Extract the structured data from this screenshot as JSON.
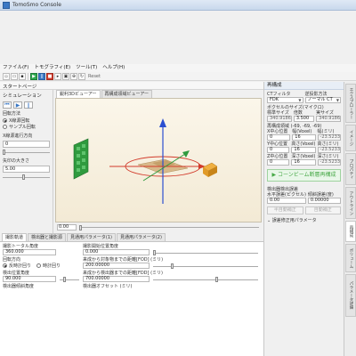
{
  "window": {
    "title": "TomoSmo Console"
  },
  "menu": [
    "ファイル(F)",
    "トモグラフィ(E)",
    "ツール(T)",
    "ヘルプ(H)"
  ],
  "toolbar": {
    "reset_label": "Reset"
  },
  "start_page": "スタートページ",
  "simulation": {
    "title": "シミュレーション",
    "rotation_method_label": "回転方法",
    "rotation_options": [
      "X線源回転",
      "サンプル回転"
    ],
    "xray_direction_label": "X線源進行方向",
    "xray_direction_value": "0",
    "arrow_size_label": "矢印の大きさ",
    "arrow_size_value": "5.00"
  },
  "viewer": {
    "tabs": [
      "鋭利3Dビューアー",
      "再構成領域ビューアー"
    ],
    "slider_value": "0.00"
  },
  "bottom": {
    "tabs": [
      "撮影軌道",
      "検出器と撮影源",
      "見通用パラメータ(1)",
      "見通用パラメータ(2)"
    ],
    "total_angle_label": "撮影トータル角度",
    "total_angle_value": "360.000",
    "start_angle_label": "撮影開始位置角度",
    "start_angle_value": "0.000",
    "rotation_label": "回転方向",
    "rotation_options": [
      "反時計回り",
      "時計回り"
    ],
    "fod_label": "来成から対象物までの距離[FOD] (ミリ)",
    "fod_value": "200.00000",
    "detector_angle_label": "検出位置角度",
    "detector_angle_value": "90.000",
    "fdd_label": "来成から検出器までの距離[FDD] (ミリ)",
    "fdd_value": "700.00000",
    "detector_tilt_label": "検出器傾斜角度",
    "detector_offset_label": "検出器オフセット (ミリ)"
  },
  "right": {
    "header": "再構成",
    "ct_filter_label": "CTフィルタ",
    "ct_filter_value": "FDK",
    "backproj_label": "逆投影方法",
    "backproj_value": "ノーマル CT",
    "voxel_size_label": "ボクセルのサイズ(マイクロ)",
    "std_size_label": "標準サイズ",
    "multiplier_label": "倍数",
    "real_size_label": "実サイズ",
    "std_size_value": "340.9186",
    "multiplier_value": "3.500",
    "real_size_value": "340.9186",
    "region_label": "再構成領域 (-69, -69, -69)",
    "x_center_label": "X中心位置",
    "y_center_label": "Y中心位置",
    "z_center_label": "Z中心位置",
    "width_voxel_label": "幅(Voxel)",
    "width_label": "幅(ミリ)",
    "height_voxel_label": "高さ(Voxel)",
    "height_label": "高さ(ミリ)",
    "depth_voxel_label": "深さ(Voxel)",
    "depth_label": "深さ(ミリ)",
    "x_center": "0",
    "x_w_voxel": "16",
    "x_w_mm": "-23.5233",
    "y_center": "0",
    "y_h_voxel": "16",
    "y_h_mm": "-23.5233",
    "z_center": "0",
    "z_d_voxel": "16",
    "z_d_mm": "-23.5233",
    "cone_beam_button": "コーンビーム断層再構成",
    "detector_ctr_label": "検出器検出誤差",
    "horiz_error_label": "水平誤差(ピクセル)",
    "tilt_error_label": "傾斜誤差(度)",
    "horiz_error_value": "0.00",
    "tilt_error_value": "0.00000",
    "half_auto_button": "半自動補正",
    "auto_button": "自動補正",
    "error_params": "誤差修正用パラメータ"
  },
  "side_tabs": [
    "エクスプローラー",
    "イメージ",
    "プロパティ",
    "アウトライン",
    "再構成",
    "ボリューム",
    "パラメータ詳細"
  ]
}
